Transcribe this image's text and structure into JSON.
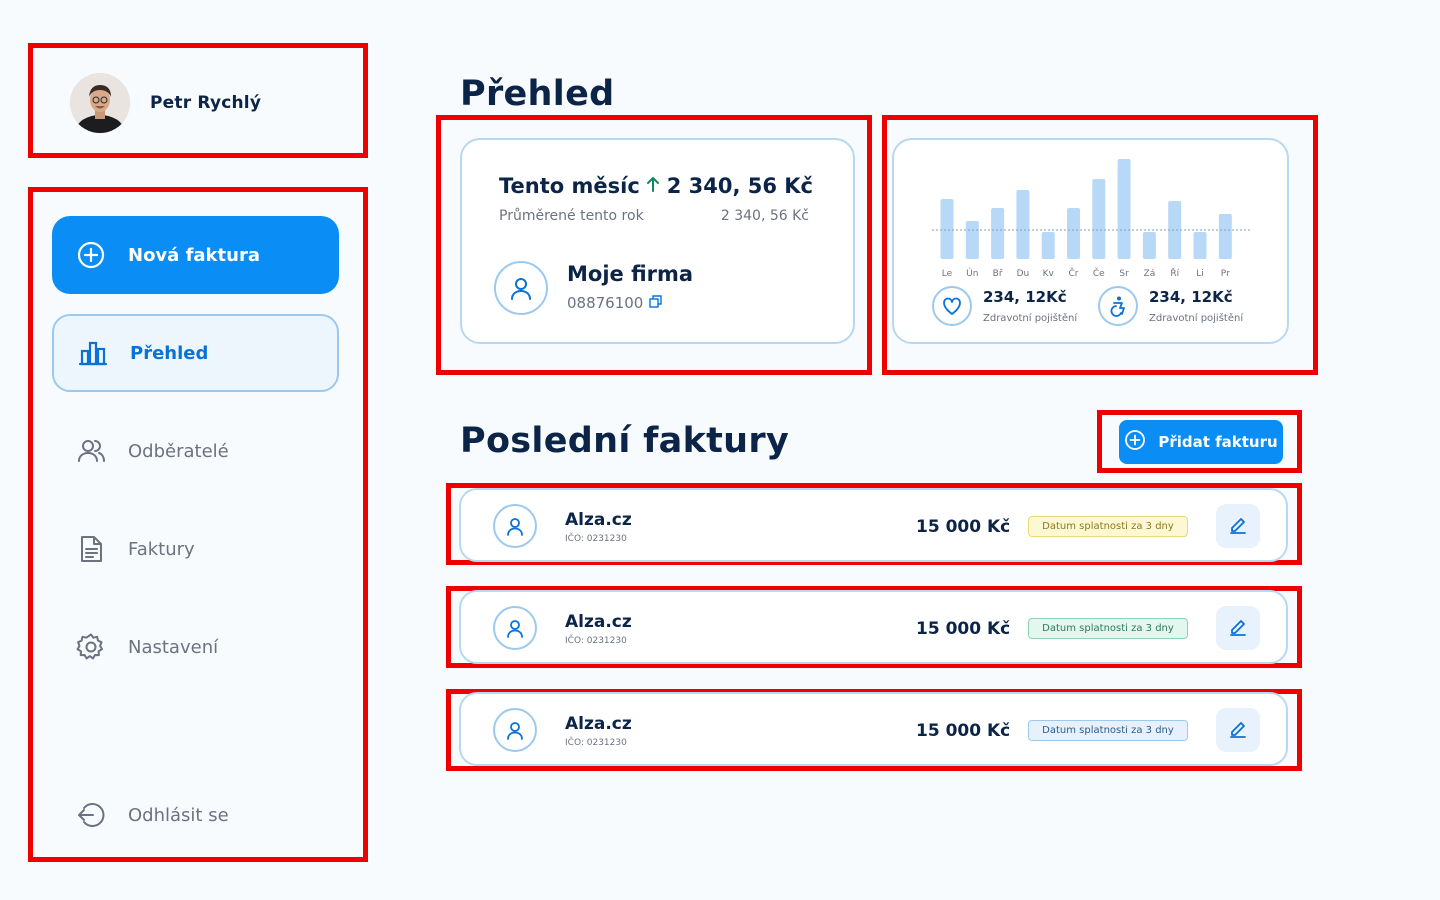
{
  "user": {
    "name": "Petr Rychlý"
  },
  "sidebar": {
    "items": [
      {
        "label": "Nová faktura",
        "icon": "plus-circle-icon"
      },
      {
        "label": "Přehled",
        "icon": "bar-chart-icon"
      },
      {
        "label": "Odběratelé",
        "icon": "users-icon"
      },
      {
        "label": "Faktury",
        "icon": "document-icon"
      },
      {
        "label": "Nastavení",
        "icon": "gear-icon"
      }
    ],
    "logout": {
      "label": "Odhlásit se",
      "icon": "logout-icon"
    }
  },
  "overview": {
    "title": "Přehled",
    "stats": {
      "month_label": "Tento měsíc",
      "month_value": "2 340, 56 Kč",
      "avg_label": "Průměrené tento rok",
      "avg_value": "2 340, 56 Kč",
      "firm_name": "Moje firma",
      "firm_id": "08876100"
    },
    "insurance": [
      {
        "value": "234, 12Kč",
        "label": "Zdravotní pojištění",
        "icon": "heart-icon"
      },
      {
        "value": "234, 12Kč",
        "label": "Zdravotní pojištění",
        "icon": "accessibility-icon"
      }
    ]
  },
  "chart_data": {
    "type": "bar",
    "categories": [
      "Le",
      "Ún",
      "Bř",
      "Du",
      "Kv",
      "Čr",
      "Če",
      "Sr",
      "Zá",
      "Ří",
      "Li",
      "Pr"
    ],
    "values": [
      60,
      38,
      51,
      69,
      27,
      51,
      80,
      100,
      27,
      58,
      27,
      45
    ],
    "ylim": [
      0,
      100
    ],
    "grid": false,
    "reference_line": "dashed horizontal average line"
  },
  "invoices": {
    "title": "Poslední faktury",
    "add_label": "Přidat fakturu",
    "rows": [
      {
        "name": "Alza.cz",
        "ico": "IČO: 0231230",
        "amount": "15 000 Kč",
        "badge": "Datum splatnosti za 3 dny",
        "badge_color": "#fdf8d3"
      },
      {
        "name": "Alza.cz",
        "ico": "IČO: 0231230",
        "amount": "15 000 Kč",
        "badge": "Datum splatnosti za 3 dny",
        "badge_color": "#e3f7ef"
      },
      {
        "name": "Alza.cz",
        "ico": "IČO: 0231230",
        "amount": "15 000 Kč",
        "badge": "Datum splatnosti za 3 dny",
        "badge_color": "#e6f1fd"
      }
    ]
  },
  "colors": {
    "accent": "#0a8ef5",
    "navy": "#0b2447",
    "bar": "#b7d8f6",
    "red_outline": "#ee0000"
  }
}
